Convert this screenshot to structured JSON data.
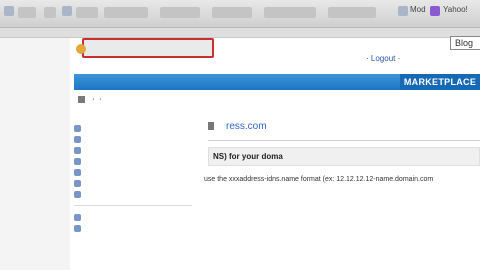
{
  "browser": {
    "right_items": [
      "Mod",
      "Yahoo!"
    ]
  },
  "header": {
    "logo_text": "",
    "top_links": "",
    "top_box": "Blog",
    "user_prefix": "",
    "user_name": "Logout",
    "user_extra": "",
    "muted_link": ""
  },
  "nav": {
    "items": [
      "",
      "",
      "",
      "",
      ""
    ],
    "marketplace": "MARKETPLACE"
  },
  "breadcrumb": {
    "items": [
      "",
      "",
      ""
    ]
  },
  "sidebar": {
    "heading": "",
    "items": [
      "",
      "",
      "",
      "",
      "",
      "",
      ""
    ],
    "heading2": "",
    "items2": [
      "",
      ""
    ]
  },
  "main": {
    "title_prefix": "",
    "domain": "ress.com",
    "section_head": "NS) for your doma",
    "paragraphs": [
      "",
      "",
      "",
      "",
      "",
      "",
      "",
      "",
      "",
      ""
    ],
    "note": "use the xxxaddress-idns.name format (ex: 12.12.12.12-name.domain.com"
  }
}
